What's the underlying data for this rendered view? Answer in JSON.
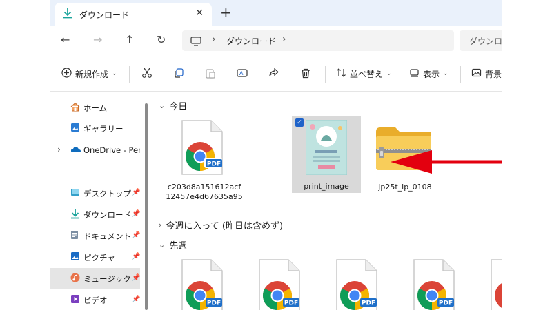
{
  "tab": {
    "title": "ダウンロード"
  },
  "address": {
    "crumb": "ダウンロード",
    "search_placeholder": "ダウンロ"
  },
  "toolbar": {
    "new_label": "新規作成",
    "sort_label": "並べ替え",
    "view_label": "表示",
    "background_label": "背景"
  },
  "sidebar": {
    "items": [
      {
        "label": "ホーム",
        "icon": "home-icon"
      },
      {
        "label": "ギャラリー",
        "icon": "gallery-icon"
      },
      {
        "label": "OneDrive - Perso",
        "icon": "onedrive-icon"
      },
      {
        "label": "デスクトップ",
        "icon": "desktop-icon",
        "pinned": true
      },
      {
        "label": "ダウンロード",
        "icon": "download-icon",
        "pinned": true
      },
      {
        "label": "ドキュメント",
        "icon": "document-icon",
        "pinned": true
      },
      {
        "label": "ピクチャ",
        "icon": "pictures-icon",
        "pinned": true
      },
      {
        "label": "ミュージック",
        "icon": "music-icon",
        "pinned": true,
        "selected": true
      },
      {
        "label": "ビデオ",
        "icon": "video-icon",
        "pinned": true
      }
    ]
  },
  "groups": {
    "today": "今日",
    "this_week": "今週に入って (昨日は含めず)",
    "last_week": "先週"
  },
  "files": {
    "today": [
      {
        "name": "c203d8a151612acf12457e4d67635a95",
        "type": "pdf"
      },
      {
        "name": "print_image",
        "type": "image",
        "selected": true
      },
      {
        "name": "jp25t_ip_0108",
        "type": "zip"
      }
    ]
  },
  "colors": {
    "arrow": "#e3000f",
    "accent": "#1f63c9",
    "folder": "#f5c542"
  }
}
